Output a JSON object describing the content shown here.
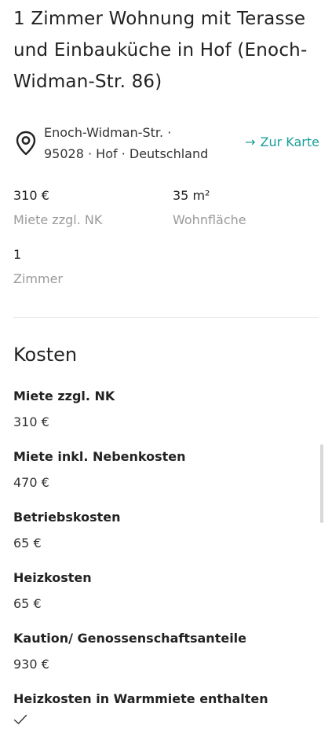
{
  "listing": {
    "title": "1 Zimmer Wohnung mit Terasse und Einbauküche in Hof (Enoch-Widman-Str. 86)",
    "address_line1": "Enoch-Widman-Str. ·",
    "address_line2": "95028 · Hof · Deutschland",
    "map_link_label": "Zur Karte",
    "map_link_arrow": "→"
  },
  "facts": [
    {
      "value": "310 €",
      "label": "Miete zzgl. NK"
    },
    {
      "value": "35 m²",
      "label": "Wohnfläche"
    },
    {
      "value": "1",
      "label": "Zimmer"
    }
  ],
  "costs": {
    "heading": "Kosten",
    "items": [
      {
        "label": "Miete zzgl. NK",
        "value": "310 €"
      },
      {
        "label": "Miete inkl. Nebenkosten",
        "value": "470 €"
      },
      {
        "label": "Betriebskosten",
        "value": "65 €"
      },
      {
        "label": "Heizkosten",
        "value": "65 €"
      },
      {
        "label": "Kaution/ Genossenschaftsanteile",
        "value": "930 €"
      },
      {
        "label": "Heizkosten in Warmmiete enthalten",
        "value": "",
        "checked": true
      }
    ]
  },
  "icons": {
    "location": "map-pin-icon",
    "arrow": "arrow-right-icon",
    "check": "check-icon"
  },
  "colors": {
    "accent": "#1a9e9a",
    "text": "#222222",
    "muted": "#9a9a9a",
    "divider": "#e6e6e6"
  }
}
